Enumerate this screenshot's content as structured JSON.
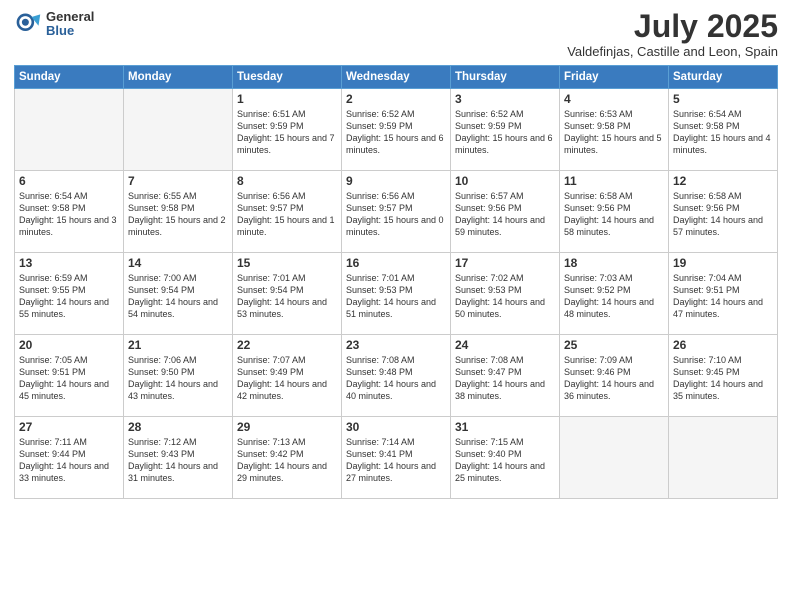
{
  "header": {
    "logo_general": "General",
    "logo_blue": "Blue",
    "month_title": "July 2025",
    "location": "Valdefinjas, Castille and Leon, Spain"
  },
  "weekdays": [
    "Sunday",
    "Monday",
    "Tuesday",
    "Wednesday",
    "Thursday",
    "Friday",
    "Saturday"
  ],
  "weeks": [
    [
      {
        "day": "",
        "empty": true
      },
      {
        "day": "",
        "empty": true
      },
      {
        "day": "1",
        "sunrise": "6:51 AM",
        "sunset": "9:59 PM",
        "daylight": "15 hours and 7 minutes."
      },
      {
        "day": "2",
        "sunrise": "6:52 AM",
        "sunset": "9:59 PM",
        "daylight": "15 hours and 6 minutes."
      },
      {
        "day": "3",
        "sunrise": "6:52 AM",
        "sunset": "9:59 PM",
        "daylight": "15 hours and 6 minutes."
      },
      {
        "day": "4",
        "sunrise": "6:53 AM",
        "sunset": "9:58 PM",
        "daylight": "15 hours and 5 minutes."
      },
      {
        "day": "5",
        "sunrise": "6:54 AM",
        "sunset": "9:58 PM",
        "daylight": "15 hours and 4 minutes."
      }
    ],
    [
      {
        "day": "6",
        "sunrise": "6:54 AM",
        "sunset": "9:58 PM",
        "daylight": "15 hours and 3 minutes."
      },
      {
        "day": "7",
        "sunrise": "6:55 AM",
        "sunset": "9:58 PM",
        "daylight": "15 hours and 2 minutes."
      },
      {
        "day": "8",
        "sunrise": "6:56 AM",
        "sunset": "9:57 PM",
        "daylight": "15 hours and 1 minute."
      },
      {
        "day": "9",
        "sunrise": "6:56 AM",
        "sunset": "9:57 PM",
        "daylight": "15 hours and 0 minutes."
      },
      {
        "day": "10",
        "sunrise": "6:57 AM",
        "sunset": "9:56 PM",
        "daylight": "14 hours and 59 minutes."
      },
      {
        "day": "11",
        "sunrise": "6:58 AM",
        "sunset": "9:56 PM",
        "daylight": "14 hours and 58 minutes."
      },
      {
        "day": "12",
        "sunrise": "6:58 AM",
        "sunset": "9:56 PM",
        "daylight": "14 hours and 57 minutes."
      }
    ],
    [
      {
        "day": "13",
        "sunrise": "6:59 AM",
        "sunset": "9:55 PM",
        "daylight": "14 hours and 55 minutes."
      },
      {
        "day": "14",
        "sunrise": "7:00 AM",
        "sunset": "9:54 PM",
        "daylight": "14 hours and 54 minutes."
      },
      {
        "day": "15",
        "sunrise": "7:01 AM",
        "sunset": "9:54 PM",
        "daylight": "14 hours and 53 minutes."
      },
      {
        "day": "16",
        "sunrise": "7:01 AM",
        "sunset": "9:53 PM",
        "daylight": "14 hours and 51 minutes."
      },
      {
        "day": "17",
        "sunrise": "7:02 AM",
        "sunset": "9:53 PM",
        "daylight": "14 hours and 50 minutes."
      },
      {
        "day": "18",
        "sunrise": "7:03 AM",
        "sunset": "9:52 PM",
        "daylight": "14 hours and 48 minutes."
      },
      {
        "day": "19",
        "sunrise": "7:04 AM",
        "sunset": "9:51 PM",
        "daylight": "14 hours and 47 minutes."
      }
    ],
    [
      {
        "day": "20",
        "sunrise": "7:05 AM",
        "sunset": "9:51 PM",
        "daylight": "14 hours and 45 minutes."
      },
      {
        "day": "21",
        "sunrise": "7:06 AM",
        "sunset": "9:50 PM",
        "daylight": "14 hours and 43 minutes."
      },
      {
        "day": "22",
        "sunrise": "7:07 AM",
        "sunset": "9:49 PM",
        "daylight": "14 hours and 42 minutes."
      },
      {
        "day": "23",
        "sunrise": "7:08 AM",
        "sunset": "9:48 PM",
        "daylight": "14 hours and 40 minutes."
      },
      {
        "day": "24",
        "sunrise": "7:08 AM",
        "sunset": "9:47 PM",
        "daylight": "14 hours and 38 minutes."
      },
      {
        "day": "25",
        "sunrise": "7:09 AM",
        "sunset": "9:46 PM",
        "daylight": "14 hours and 36 minutes."
      },
      {
        "day": "26",
        "sunrise": "7:10 AM",
        "sunset": "9:45 PM",
        "daylight": "14 hours and 35 minutes."
      }
    ],
    [
      {
        "day": "27",
        "sunrise": "7:11 AM",
        "sunset": "9:44 PM",
        "daylight": "14 hours and 33 minutes."
      },
      {
        "day": "28",
        "sunrise": "7:12 AM",
        "sunset": "9:43 PM",
        "daylight": "14 hours and 31 minutes."
      },
      {
        "day": "29",
        "sunrise": "7:13 AM",
        "sunset": "9:42 PM",
        "daylight": "14 hours and 29 minutes."
      },
      {
        "day": "30",
        "sunrise": "7:14 AM",
        "sunset": "9:41 PM",
        "daylight": "14 hours and 27 minutes."
      },
      {
        "day": "31",
        "sunrise": "7:15 AM",
        "sunset": "9:40 PM",
        "daylight": "14 hours and 25 minutes."
      },
      {
        "day": "",
        "empty": true
      },
      {
        "day": "",
        "empty": true
      }
    ]
  ]
}
